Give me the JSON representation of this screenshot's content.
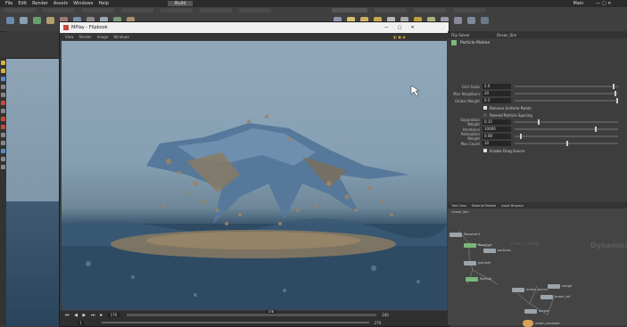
{
  "main_menu": [
    "File",
    "Edit",
    "Render",
    "Assets",
    "Windows",
    "Help"
  ],
  "main_title": "Main",
  "desktop_label": "Build",
  "mplay": {
    "title": "MPlay - Flipbook",
    "menu": [
      "View",
      "Render",
      "Image",
      "Windows"
    ],
    "frame_current": "176",
    "frame_marker": "176",
    "frame_start": "1",
    "frame_end": "240",
    "range_start": "1",
    "range_end": "270",
    "range2_start": "100",
    "range2_end": "270"
  },
  "right_panel": {
    "node_name": "Ocean_Sim",
    "path_label": "Flip Solver",
    "tabs": [
      "Tree View",
      "Material Palette",
      "Asset Browser"
    ],
    "section": "Particle Motion",
    "params": [
      {
        "label": "Grid Scale",
        "value": "2.0"
      },
      {
        "label": "Max Neighbors",
        "value": "20"
      },
      {
        "label": "Global Weight",
        "value": "0.5"
      }
    ],
    "checkbox1": "Remove Uniform Points",
    "checkbox2": "Reseed Particle Spacing",
    "params2": [
      {
        "label": "Separation Weight",
        "value": "0.15"
      },
      {
        "label": "Iterations",
        "value": "10000"
      },
      {
        "label": "Relaxation Weight",
        "value": "0.08"
      },
      {
        "label": "Max Count",
        "value": "10"
      }
    ],
    "checkbox3": "Enable Drag Source",
    "net_title": "Ocean_Sim",
    "net_watermark": "Dynamics",
    "net_section": "Flow / Collide",
    "nodes": [
      "flipsolver1",
      "flipsolver",
      "particles",
      "pointvel",
      "flipfluid",
      "ocean_source",
      "ocean_ref",
      "output",
      "merge",
      "ocean_evaluate"
    ]
  },
  "colors": {
    "node_green": "#7ab77a",
    "node_gray": "#9aa4ab",
    "node_orange": "#d9a05a",
    "tool_red": "#c84b3c",
    "tool_yellow": "#d8b13c",
    "tool_blue": "#5a8cc8"
  }
}
